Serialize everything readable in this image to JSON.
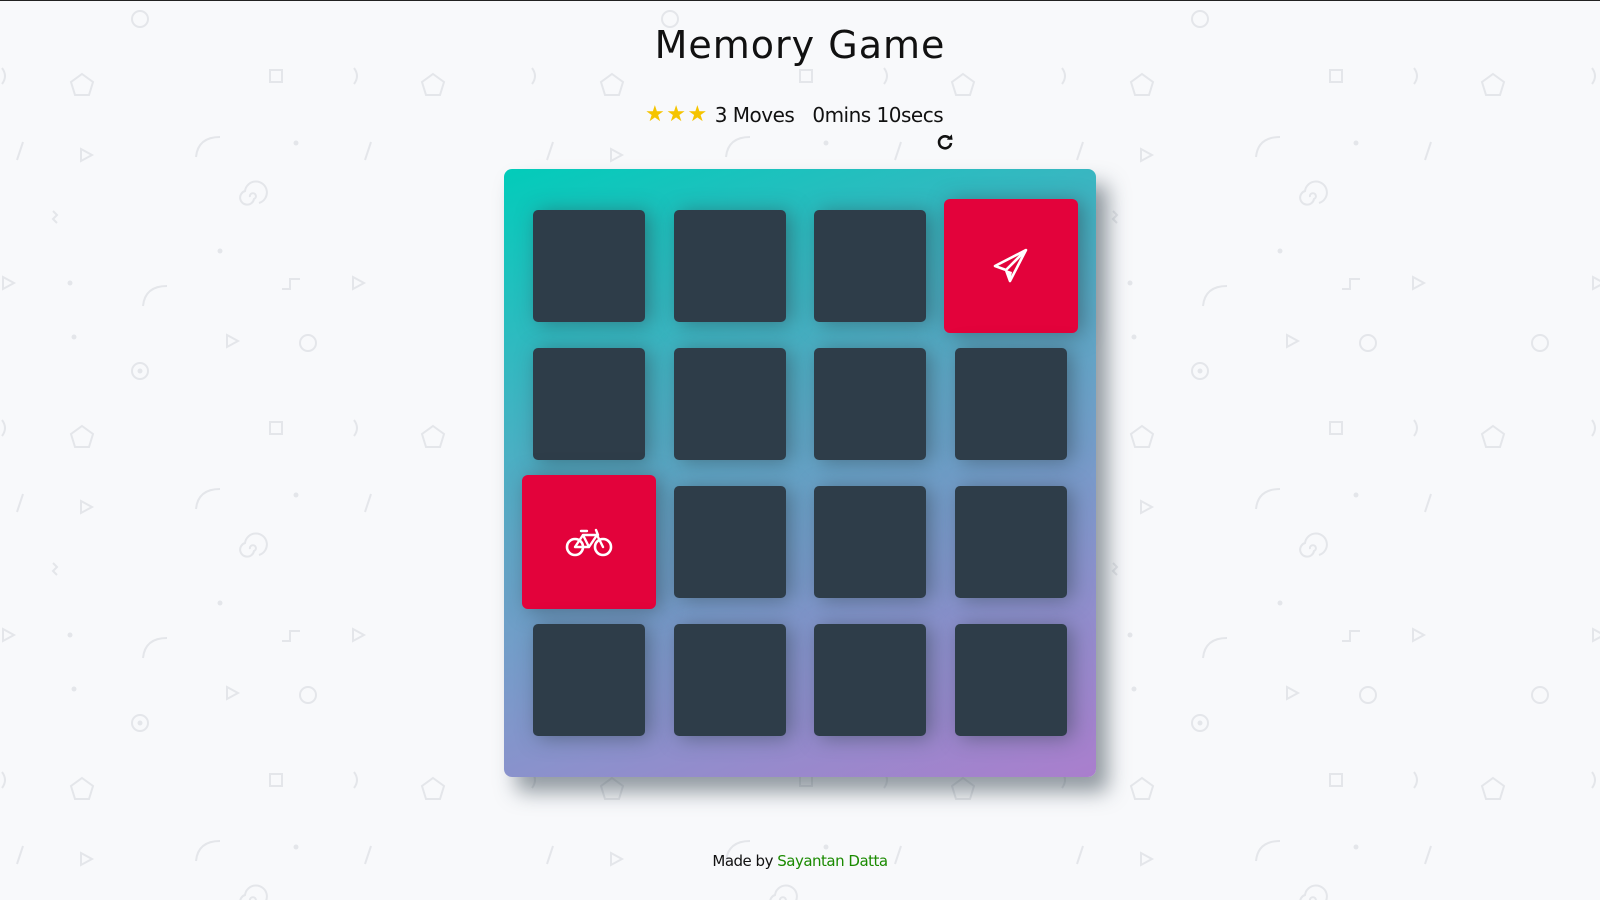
{
  "page": {
    "title": "Memory Game"
  },
  "score_panel": {
    "stars": [
      "★",
      "★",
      "★"
    ],
    "star_count": 3,
    "moves_label": "3 Moves",
    "timer_label": "0mins 10secs",
    "restart_icon": "redo-icon"
  },
  "deck": {
    "card_back_color": "#2e3d49",
    "card_open_color": "#e3023b",
    "gradient": [
      "#02ccba",
      "#aa7ecd"
    ],
    "rows": 4,
    "columns": 4,
    "open_cards": [
      {
        "row": 1,
        "column": 4,
        "icon": "paper-plane-icon"
      },
      {
        "row": 3,
        "column": 1,
        "icon": "bicycle-icon"
      }
    ]
  },
  "footer": {
    "prefix": "Made by",
    "author": "Sayantan Datta",
    "author_color": "#1a8a00"
  },
  "colors": {
    "star": "#f5c400",
    "background": "#f8f9fb"
  }
}
